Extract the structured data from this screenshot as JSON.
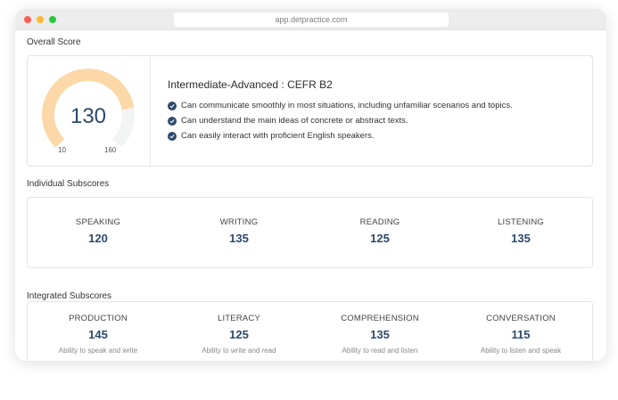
{
  "browser": {
    "url": "app.detpractice.com"
  },
  "overall": {
    "section_title": "Overall Score",
    "score": "130",
    "score_value": 130,
    "min_label": "10",
    "max_label": "160",
    "min": 10,
    "max": 160,
    "level_title": "Intermediate-Advanced : CEFR B2",
    "bullets": [
      "Can communicate smoothly in most situations, including unfamiliar scenarios and topics.",
      "Can understand the main ideas of concrete or abstract texts.",
      "Can easily interact with proficient English speakers."
    ]
  },
  "individual": {
    "section_title": "Individual Subscores",
    "items": [
      {
        "label": "SPEAKING",
        "value": "120"
      },
      {
        "label": "WRITING",
        "value": "135"
      },
      {
        "label": "READING",
        "value": "125"
      },
      {
        "label": "LISTENING",
        "value": "135"
      }
    ]
  },
  "integrated": {
    "section_title": "Integrated Subscores",
    "items": [
      {
        "label": "PRODUCTION",
        "value": "145",
        "desc": "Ability to speak and write"
      },
      {
        "label": "LITERACY",
        "value": "125",
        "desc": "Ability to write and read"
      },
      {
        "label": "COMPREHENSION",
        "value": "135",
        "desc": "Ability to read and listen"
      },
      {
        "label": "CONVERSATION",
        "value": "115",
        "desc": "Ability to listen and speak"
      }
    ]
  },
  "colors": {
    "gauge_fill": "#fcd8a8",
    "gauge_track": "#f2f3f3",
    "accent": "#2c4a6b"
  }
}
